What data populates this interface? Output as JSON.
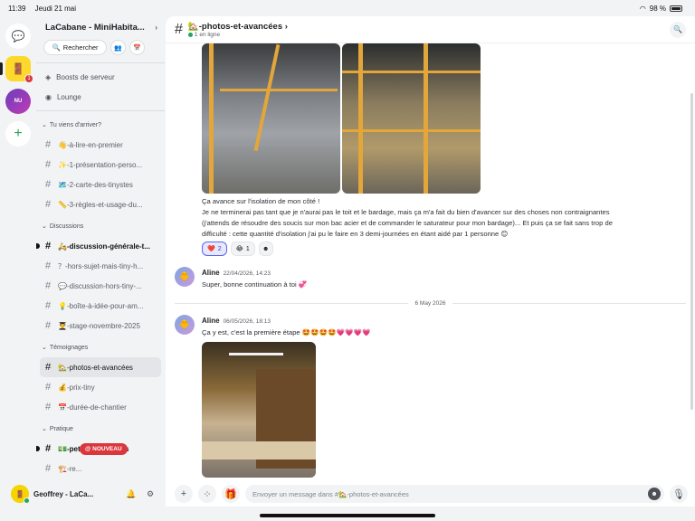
{
  "status_bar": {
    "time": "11:39",
    "date": "Jeudi 21 mai",
    "battery": "98 %"
  },
  "rail": {
    "badge": "1",
    "guild2_label": "NU"
  },
  "server": {
    "name": "LaCabane - MiniHabita...",
    "search_label": "Rechercher"
  },
  "nav": {
    "boosts": "Boosts de serveur",
    "lounge": "Lounge"
  },
  "sections": {
    "arrival": "Tu viens d'arriver?",
    "discussions": "Discussions",
    "temoignages": "Témoignages",
    "pratique": "Pratique"
  },
  "channels": {
    "arrival": [
      "👋-à-lire-en-premier",
      "✨-1-présentation-perso...",
      "🗺️-2-carte-des-tinystes",
      "📏-3-règles-et-usage-du..."
    ],
    "discussions": [
      "🛵-discussion-générale-t...",
      "？-hors-sujet-mais-tiny-h...",
      "💬-discussion-hors-tiny-...",
      "💡-boîte-à-idée-pour-am...",
      "👨‍🎓-stage-novembre-2025"
    ],
    "temoignages": [
      "🏡-photos-et-avancées",
      "💰-prix-tiny",
      "📅-durée-de-chantier"
    ],
    "pratique": [
      "💵-petites-annonces",
      "🏗️-re..."
    ]
  },
  "nouveau_badge": "@ NOUVEAU",
  "user": {
    "name": "Geoffrey - LaCa..."
  },
  "channel_header": {
    "title": "🏡-photos-et-avancées",
    "subtitle": "1 en ligne"
  },
  "messages": {
    "first_text_lines": [
      "Ça avance sur l'isolation de mon côté !",
      "Je ne terminerai pas tant que je n'aurai pas le toit et le bardage, mais ça m'a fait du bien d'avancer sur des choses non contraignantes",
      "(j'attends de résoudre des soucis sur mon bac acier et de commander le saturateur pour mon bardage)... Et puis ça se fait sans trop de",
      "difficulté : cette quantité d'isolation j'ai pu le faire en 3 demi-journées en étant aidé par 1 personne 😊"
    ],
    "reactions": [
      {
        "emoji": "❤️",
        "count": "2"
      },
      {
        "emoji": "😂",
        "count": "1"
      }
    ],
    "reply1": {
      "author": "Aline",
      "time": "22/04/2026, 14:23",
      "text": "Super, bonne continuation à toi 💞"
    },
    "date_separator": "6 May 2026",
    "reply2": {
      "author": "Aline",
      "time": "06/05/2026, 18:13",
      "text": "Ça y est, c'est la première étape 🤩🤩🤩🤩💗💗💗💗"
    }
  },
  "composer": {
    "placeholder": "Envoyer un message dans #🏡-photos-et-avancées"
  }
}
